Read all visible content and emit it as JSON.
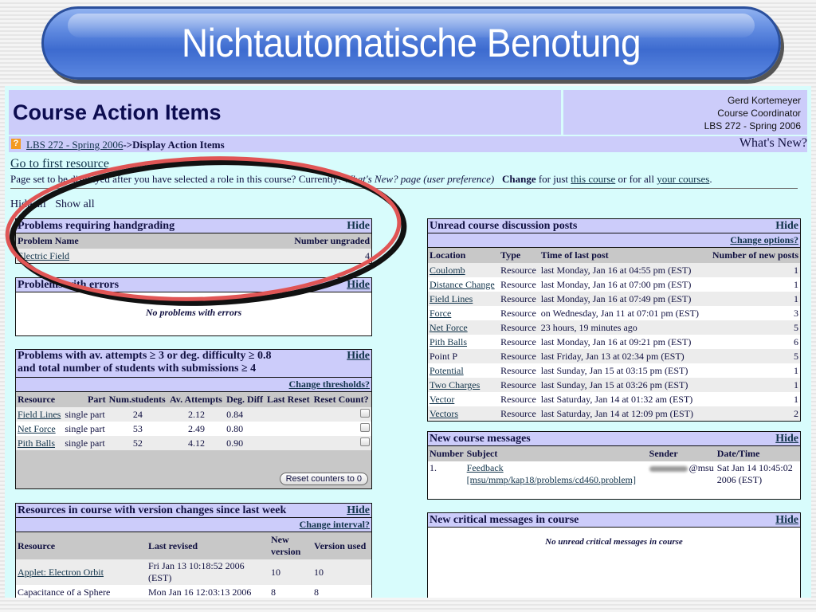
{
  "slide": {
    "title": "Nichtautomatische Benotung",
    "annotation": "red-black-ellipse-highlight"
  },
  "header": {
    "title": "Course Action Items",
    "user_name": "Gerd Kortemeyer",
    "user_role": "Course Coordinator",
    "course": "LBS 272 - Spring 2006"
  },
  "breadcrumb": {
    "help_icon": "?",
    "course_link": "LBS 272 - Spring 2006",
    "separator": "->",
    "current": "Display Action Items",
    "whats_new": "What's New?"
  },
  "intro": {
    "go_first": "Go to first resource",
    "pageset_prefix": "Page set to be displayed after you have selected a role in this course? Currently: ",
    "pageset_current": "What's New? page (user preference)",
    "change_label": "Change",
    "change_mid": " for just ",
    "this_course": "this course",
    "change_or": " or for all ",
    "your_courses": "your courses",
    "period": ".",
    "hide_all": "Hide all",
    "show_all": "Show all"
  },
  "handgrading": {
    "title": "Problems requiring handgrading",
    "hide": "Hide",
    "columns": [
      "Problem Name",
      "Number ungraded"
    ],
    "rows": [
      {
        "name": "Electric Field",
        "count": "4"
      }
    ]
  },
  "errors": {
    "title": "Problems with errors",
    "hide": "Hide",
    "empty": "No problems with errors"
  },
  "attempts": {
    "title_line1": "Problems with av. attempts ≥ 3 or deg. difficulty ≥ 0.8",
    "title_line2": "and total number of students with submissions ≥ 4",
    "hide": "Hide",
    "change": "Change thresholds?",
    "columns": [
      "Resource",
      "Part",
      "Num.students",
      "Av. Attempts",
      "Deg. Diff",
      "Last Reset",
      "Reset Count?"
    ],
    "rows": [
      {
        "resource": "Field Lines",
        "part": "single part",
        "students": "24",
        "attempts": "2.12",
        "diff": "0.84",
        "last_reset": "",
        "checked": false
      },
      {
        "resource": "Net Force",
        "part": "single part",
        "students": "53",
        "attempts": "2.49",
        "diff": "0.80",
        "last_reset": "",
        "checked": false
      },
      {
        "resource": "Pith Balls",
        "part": "single part",
        "students": "52",
        "attempts": "4.12",
        "diff": "0.90",
        "last_reset": "",
        "checked": false
      }
    ],
    "reset_button": "Reset counters to 0"
  },
  "versions": {
    "title": "Resources in course with version changes since last week",
    "hide": "Hide",
    "change": "Change interval?",
    "columns": [
      "Resource",
      "Last revised",
      "New version",
      "Version used"
    ],
    "rows": [
      {
        "resource": "Applet: Electron Orbit",
        "revised": "Fri Jan 13 10:18:52 2006 (EST)",
        "new": "10",
        "used": "10",
        "link": true
      },
      {
        "resource": "Capacitance of a Sphere",
        "revised": "Mon Jan 16 12:03:13 2006",
        "new": "8",
        "used": "8",
        "link": false
      }
    ]
  },
  "discussion": {
    "title": "Unread course discussion posts",
    "hide": "Hide",
    "change": "Change options?",
    "columns": [
      "Location",
      "Type",
      "Time of last post",
      "Number of new posts"
    ],
    "rows": [
      {
        "location": "Coulomb",
        "type": "Resource",
        "time": "last Monday, Jan 16 at 04:55 pm (EST)",
        "count": "1",
        "link": true
      },
      {
        "location": "Distance Change",
        "type": "Resource",
        "time": "last Monday, Jan 16 at 07:00 pm (EST)",
        "count": "1",
        "link": true
      },
      {
        "location": "Field Lines",
        "type": "Resource",
        "time": "last Monday, Jan 16 at 07:49 pm (EST)",
        "count": "1",
        "link": true
      },
      {
        "location": "Force",
        "type": "Resource",
        "time": "on Wednesday, Jan 11 at 07:01 pm (EST)",
        "count": "3",
        "link": true
      },
      {
        "location": "Net Force",
        "type": "Resource",
        "time": "23 hours, 19 minutes ago",
        "count": "5",
        "link": true
      },
      {
        "location": "Pith Balls",
        "type": "Resource",
        "time": "last Monday, Jan 16 at 09:21 pm (EST)",
        "count": "6",
        "link": true
      },
      {
        "location": "Point P",
        "type": "Resource",
        "time": "last Friday, Jan 13 at 02:34 pm (EST)",
        "count": "5",
        "link": false
      },
      {
        "location": "Potential",
        "type": "Resource",
        "time": "last Sunday, Jan 15 at 03:15 pm (EST)",
        "count": "1",
        "link": true
      },
      {
        "location": "Two Charges",
        "type": "Resource",
        "time": "last Sunday, Jan 15 at 03:26 pm (EST)",
        "count": "1",
        "link": true
      },
      {
        "location": "Vector",
        "type": "Resource",
        "time": "last Saturday, Jan 14 at 01:32 am (EST)",
        "count": "1",
        "link": true
      },
      {
        "location": "Vectors",
        "type": "Resource",
        "time": "last Saturday, Jan 14 at 12:09 pm (EST)",
        "count": "2",
        "link": true
      }
    ]
  },
  "messages": {
    "title": "New course messages",
    "hide": "Hide",
    "columns": [
      "Number",
      "Subject",
      "Sender",
      "Date/Time"
    ],
    "rows": [
      {
        "number": "1.",
        "subject_line1": "Feedback",
        "subject_line2": "[msu/mmp/kap18/problems/cd460.problem]",
        "sender": "@msu",
        "date_line1": "Sat Jan 14 10:45:02",
        "date_line2": "2006 (EST)"
      }
    ]
  },
  "critical": {
    "title": "New critical messages in course",
    "hide": "Hide",
    "empty": "No unread critical messages in course"
  }
}
